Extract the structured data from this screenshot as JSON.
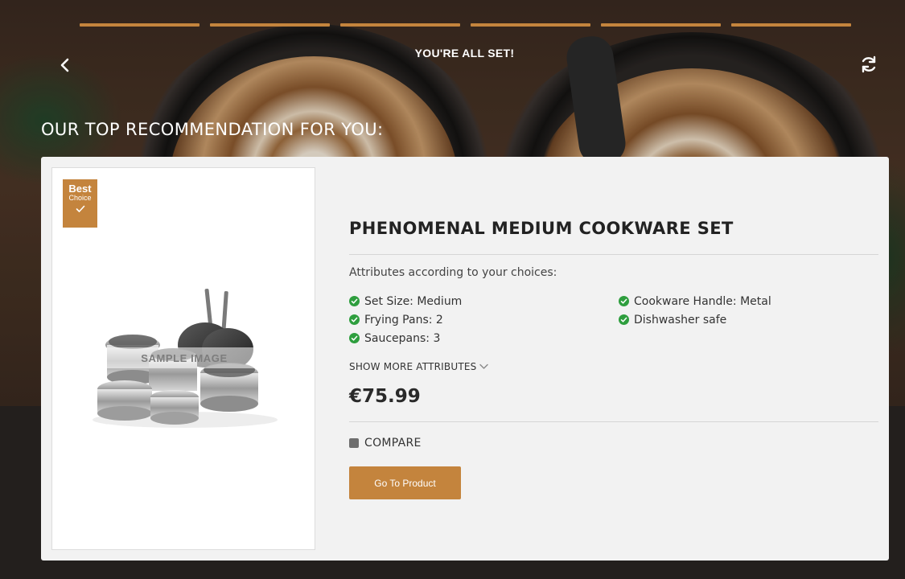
{
  "progress": {
    "total_steps": 6,
    "completed_steps": 6
  },
  "status": {
    "text": "YOU'RE ALL SET!"
  },
  "section": {
    "title": "OUR TOP RECOMMENDATION FOR YOU:"
  },
  "product": {
    "badge": {
      "line1": "Best",
      "line2": "Choice"
    },
    "image_label": "SAMPLE IMAGE",
    "title": "PHENOMENAL MEDIUM COOKWARE SET",
    "attributes_intro": "Attributes according to your choices:",
    "attributes_left": [
      "Set Size: Medium",
      "Frying Pans: 2",
      "Saucepans: 3"
    ],
    "attributes_right": [
      "Cookware Handle: Metal",
      "Dishwasher safe"
    ],
    "show_more": "SHOW MORE ATTRIBUTES",
    "price": "€75.99",
    "compare_label": "COMPARE",
    "cta_label": "Go To Product"
  },
  "colors": {
    "accent": "#c4843d",
    "check": "#2e9e3e",
    "card_bg": "#f2f2f2",
    "page_bg": "#231f1d"
  },
  "icons": {
    "back": "chevron-left-icon",
    "restart": "refresh-icon",
    "badge": "checkmark-icon",
    "expand": "chevron-down-icon",
    "attribute": "check-circle-icon"
  }
}
